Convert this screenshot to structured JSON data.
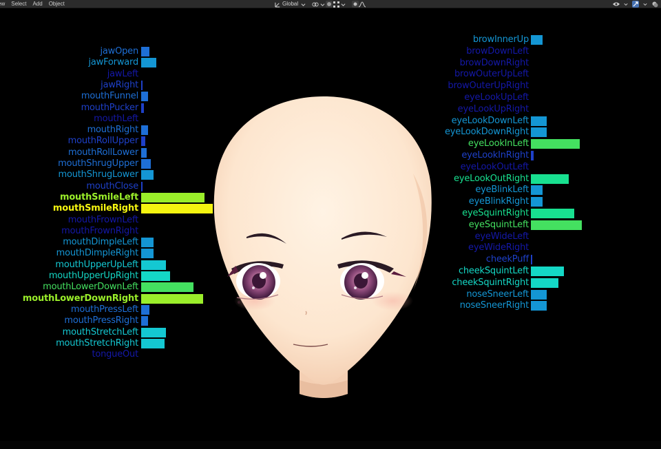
{
  "menu": {
    "view": "ew",
    "select": "Select",
    "add": "Add",
    "object": "Object"
  },
  "toolbar": {
    "orientation": "Global"
  },
  "colors": {
    "header_bg": "#2b2b2b",
    "viewport_bg": "#000000",
    "skin": "#fde8d3"
  },
  "left_blendshapes": [
    {
      "name": "jawOpen",
      "value": 0.06
    },
    {
      "name": "jawForward",
      "value": 0.11
    },
    {
      "name": "jawLeft",
      "value": 0.0
    },
    {
      "name": "jawRight",
      "value": 0.01
    },
    {
      "name": "mouthFunnel",
      "value": 0.05
    },
    {
      "name": "mouthPucker",
      "value": 0.02
    },
    {
      "name": "mouthLeft",
      "value": 0.0
    },
    {
      "name": "mouthRight",
      "value": 0.05
    },
    {
      "name": "mouthRollUpper",
      "value": 0.03
    },
    {
      "name": "mouthRollLower",
      "value": 0.04
    },
    {
      "name": "mouthShrugUpper",
      "value": 0.07
    },
    {
      "name": "mouthShrugLower",
      "value": 0.09
    },
    {
      "name": "mouthClose",
      "value": 0.01
    },
    {
      "name": "mouthSmileLeft",
      "value": 0.46
    },
    {
      "name": "mouthSmileRight",
      "value": 0.52
    },
    {
      "name": "mouthFrownLeft",
      "value": 0.0
    },
    {
      "name": "mouthFrownRight",
      "value": 0.0
    },
    {
      "name": "mouthDimpleLeft",
      "value": 0.09
    },
    {
      "name": "mouthDimpleRight",
      "value": 0.09
    },
    {
      "name": "mouthUpperUpLeft",
      "value": 0.18
    },
    {
      "name": "mouthUpperUpRight",
      "value": 0.21
    },
    {
      "name": "mouthLowerDownLeft",
      "value": 0.38
    },
    {
      "name": "mouthLowerDownRight",
      "value": 0.45
    },
    {
      "name": "mouthPressLeft",
      "value": 0.06
    },
    {
      "name": "mouthPressRight",
      "value": 0.05
    },
    {
      "name": "mouthStretchLeft",
      "value": 0.18
    },
    {
      "name": "mouthStretchRight",
      "value": 0.17
    },
    {
      "name": "tongueOut",
      "value": 0.0
    }
  ],
  "right_blendshapes": [
    {
      "name": "browInnerUp",
      "value": 0.08
    },
    {
      "name": "browDownLeft",
      "value": 0.0
    },
    {
      "name": "browDownRight",
      "value": 0.0
    },
    {
      "name": "browOuterUpLeft",
      "value": 0.0
    },
    {
      "name": "browOuterUpRight",
      "value": 0.0
    },
    {
      "name": "eyeLookUpLeft",
      "value": 0.0
    },
    {
      "name": "eyeLookUpRight",
      "value": 0.0
    },
    {
      "name": "eyeLookDownLeft",
      "value": 0.11
    },
    {
      "name": "eyeLookDownRight",
      "value": 0.11
    },
    {
      "name": "eyeLookInLeft",
      "value": 0.34
    },
    {
      "name": "eyeLookInRight",
      "value": 0.02
    },
    {
      "name": "eyeLookOutLeft",
      "value": 0.0
    },
    {
      "name": "eyeLookOutRight",
      "value": 0.26
    },
    {
      "name": "eyeBlinkLeft",
      "value": 0.08
    },
    {
      "name": "eyeBlinkRight",
      "value": 0.08
    },
    {
      "name": "eyeSquintRight",
      "value": 0.3
    },
    {
      "name": "eyeSquintLeft",
      "value": 0.35
    },
    {
      "name": "eyeWideLeft",
      "value": 0.0
    },
    {
      "name": "eyeWideRight",
      "value": 0.0
    },
    {
      "name": "cheekPuff",
      "value": 0.01
    },
    {
      "name": "cheekSquintLeft",
      "value": 0.23
    },
    {
      "name": "cheekSquintRight",
      "value": 0.19
    },
    {
      "name": "noseSneerLeft",
      "value": 0.11
    },
    {
      "name": "noseSneerRight",
      "value": 0.11
    }
  ]
}
